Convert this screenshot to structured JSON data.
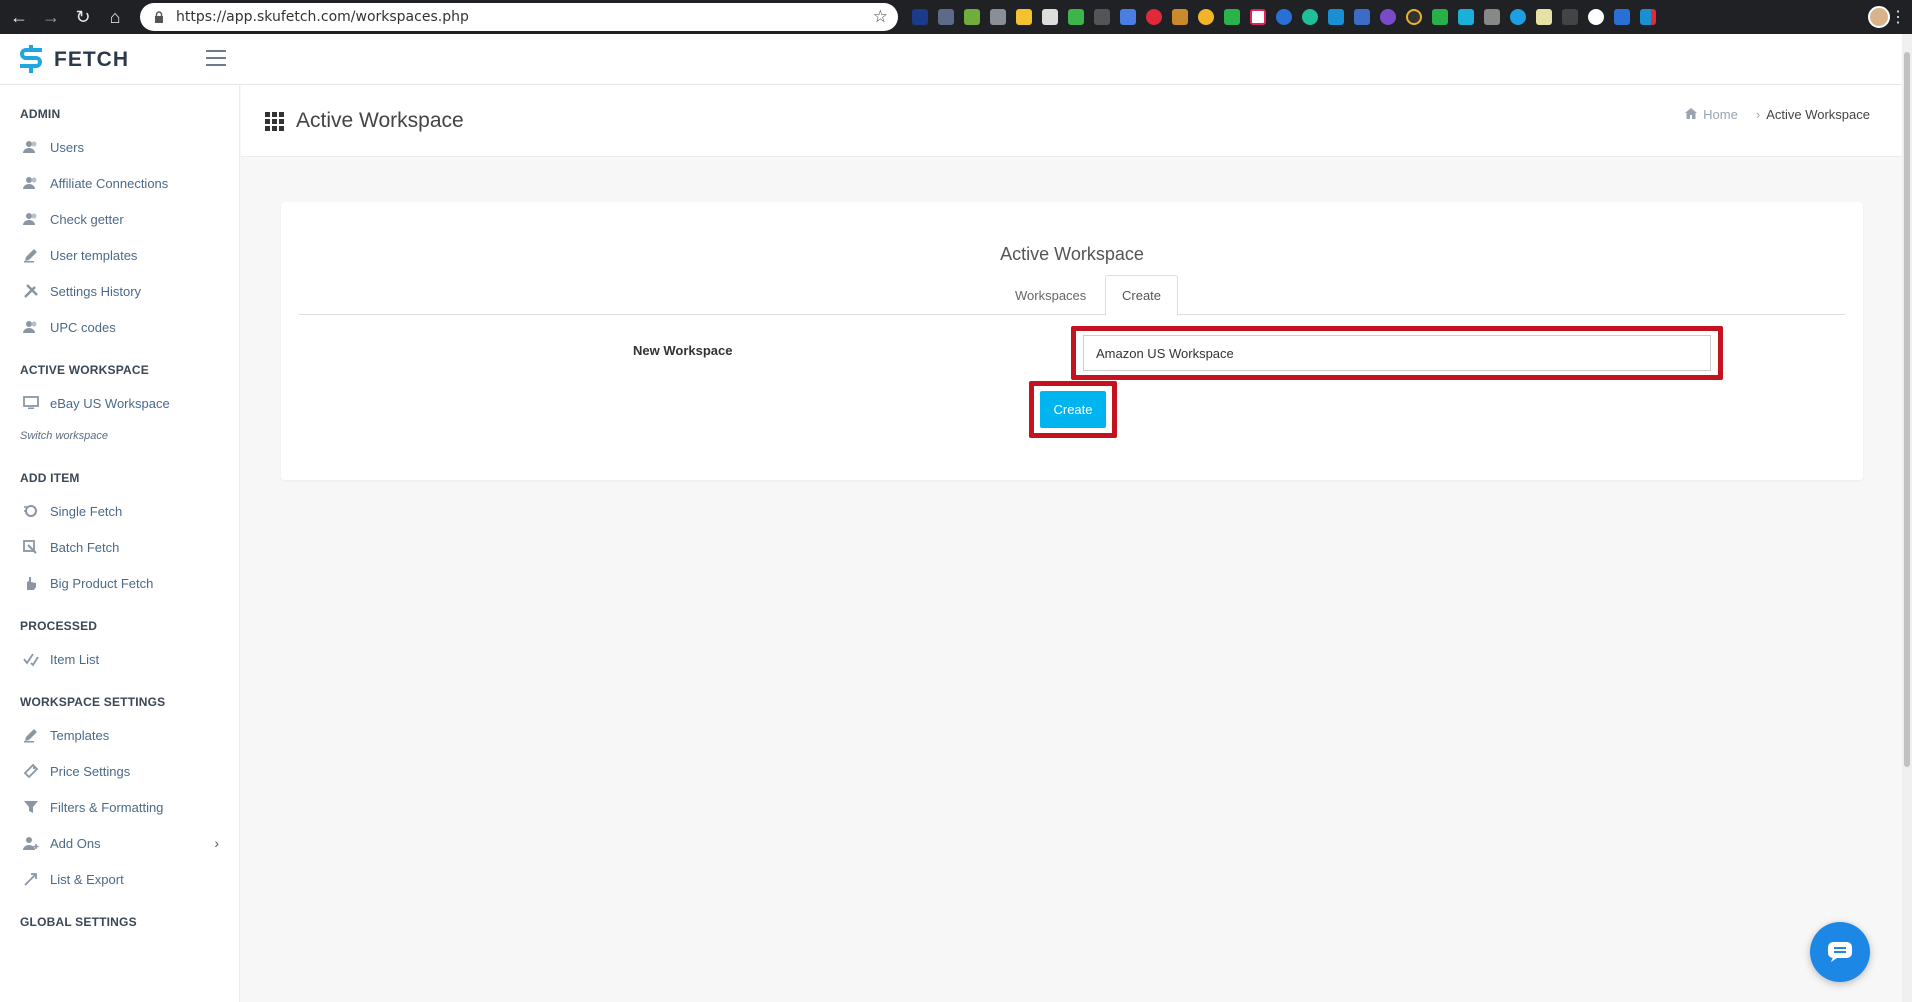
{
  "browser": {
    "url": "https://app.skufetch.com/workspaces.php"
  },
  "header": {
    "logo_text": "FETCH"
  },
  "sidebar": {
    "sections": {
      "admin": "ADMIN",
      "active_workspace": "ACTIVE WORKSPACE",
      "add_item": "ADD ITEM",
      "processed": "PROCESSED",
      "workspace_settings": "WORKSPACE SETTINGS",
      "global_settings": "GLOBAL SETTINGS"
    },
    "admin_items": [
      "Users",
      "Affiliate Connections",
      "Check getter",
      "User templates",
      "Settings History",
      "UPC codes"
    ],
    "active_workspace_item": "eBay US Workspace",
    "switch_workspace": "Switch workspace",
    "add_item_items": [
      "Single Fetch",
      "Batch Fetch",
      "Big Product Fetch"
    ],
    "processed_items": [
      "Item List"
    ],
    "workspace_settings_items": [
      "Templates",
      "Price Settings",
      "Filters & Formatting",
      "Add Ons",
      "List & Export"
    ]
  },
  "page": {
    "title": "Active Workspace",
    "breadcrumb": {
      "home": "Home",
      "current": "Active Workspace"
    }
  },
  "card": {
    "title": "Active Workspace",
    "tabs": [
      "Workspaces",
      "Create"
    ],
    "form_label": "New Workspace",
    "input_value": "Amazon US Workspace",
    "create_button": "Create"
  },
  "colors": {
    "accent": "#00b5ef",
    "highlight": "#c4131f",
    "brand": "#1ea7e0",
    "chat": "#1c87e5"
  }
}
